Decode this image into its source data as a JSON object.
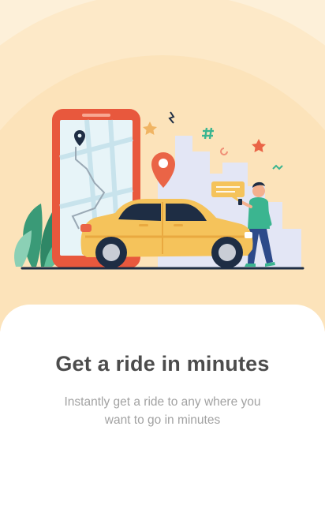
{
  "onboarding": {
    "title": "Get a ride in minutes",
    "subtitle": "Instantly get a ride to any where you want to go in minutes"
  },
  "illustration": {
    "subject": "car-ride-illustration",
    "colors": {
      "background": "#fdf0d9",
      "phone": "#e8583d",
      "car": "#f5c35b",
      "pin": "#ea6446",
      "accent_green": "#3bb590",
      "skyline": "#e3e6f5"
    }
  }
}
